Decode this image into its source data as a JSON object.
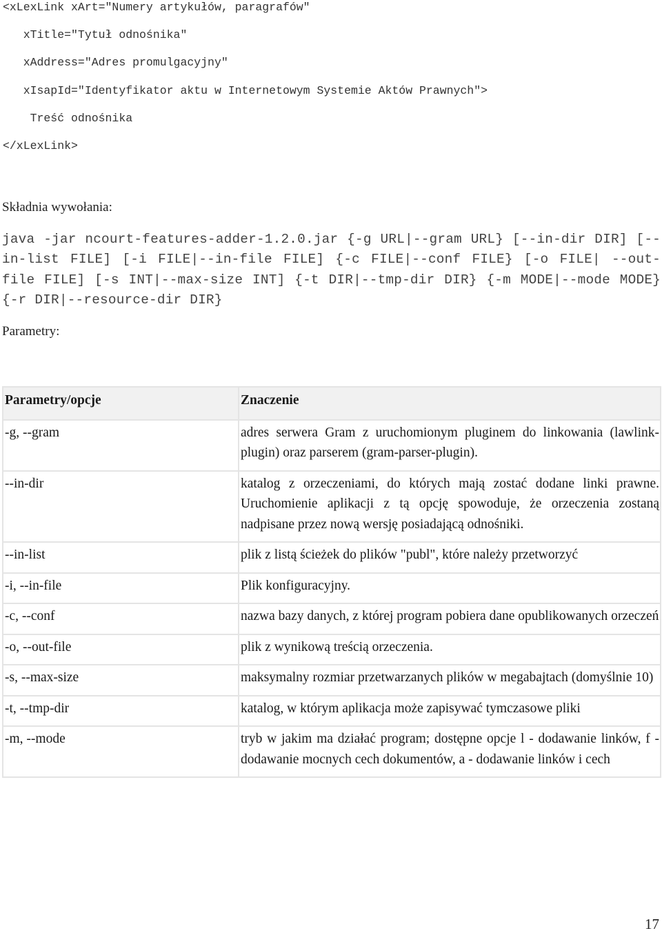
{
  "code_example": {
    "lines": [
      "<xLexLink xArt=\"Numery artykułów, paragrafów\"",
      "   xTitle=\"Tytuł odnośnika\"",
      "   xAddress=\"Adres promulgacyjny\"",
      "   xIsapId=\"Identyfikator aktu w Internetowym Systemie Aktów Prawnych\">",
      "    Treść odnośnika",
      "</xLexLink>"
    ]
  },
  "syntax_heading": "Składnia wywołania:",
  "syntax_command": "java -jar ncourt-features-adder-1.2.0.jar {-g URL|--gram URL} [--in-dir DIR] [--in-list FILE] [-i FILE|--in-file FILE] {-c FILE|--conf FILE} [-o FILE| --out-file FILE] [-s INT|--max-size INT] {-t DIR|--tmp-dir DIR} {-m MODE|--mode MODE} {-r DIR|--resource-dir DIR}",
  "params_heading": "Parametry:",
  "table": {
    "headers": [
      "Parametry/opcje",
      "Znaczenie"
    ],
    "rows": [
      {
        "option": "-g, --gram",
        "description": "adres serwera Gram z uruchomionym pluginem do linkowania (lawlink-plugin) oraz parserem (gram-parser-plugin)."
      },
      {
        "option": "--in-dir",
        "description": "katalog z orzeczeniami, do których mają zostać dodane linki prawne. Uruchomienie aplikacji z tą opcję spowoduje, że orzeczenia zostaną nadpisane przez nową wersję posiadającą odnośniki."
      },
      {
        "option": "--in-list",
        "description": "plik z listą ścieżek do plików \"publ\", które należy przetworzyć"
      },
      {
        "option": "-i, --in-file",
        "description": "Plik konfiguracyjny."
      },
      {
        "option": "-c, --conf",
        "description": "nazwa bazy danych, z której program pobiera dane opublikowanych orzeczeń"
      },
      {
        "option": "-o, --out-file",
        "description": "plik z wynikową treścią orzeczenia."
      },
      {
        "option": "-s, --max-size",
        "description": "maksymalny rozmiar przetwarzanych plików w megabajtach (domyślnie 10)"
      },
      {
        "option": "-t, --tmp-dir",
        "description": "katalog, w którym aplikacja może zapisywać tymczasowe pliki"
      },
      {
        "option": "-m, --mode",
        "description": "tryb w jakim ma działać program; dostępne opcje l - dodawanie linków, f - dodawanie mocnych cech dokumentów, a - dodawanie linków i cech"
      }
    ]
  },
  "page_number": "17"
}
